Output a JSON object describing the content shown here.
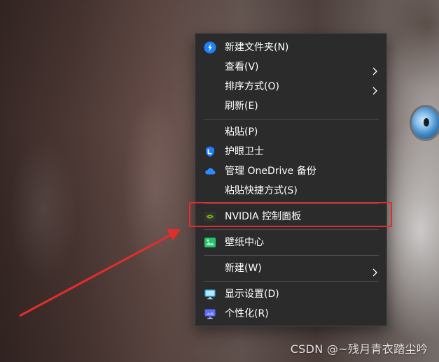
{
  "menu": {
    "items": [
      {
        "label": "新建文件夹(N)",
        "icon": "new-folder-icon"
      },
      {
        "label": "查看(V)",
        "icon": "",
        "submenu": true
      },
      {
        "label": "排序方式(O)",
        "icon": "",
        "submenu": true
      },
      {
        "label": "刷新(E)",
        "icon": ""
      },
      {
        "label": "粘贴(P)",
        "icon": ""
      },
      {
        "label": "护眼卫士",
        "icon": "shield-icon"
      },
      {
        "label": "管理 OneDrive 备份",
        "icon": "cloud-icon"
      },
      {
        "label": "粘贴快捷方式(S)",
        "icon": ""
      },
      {
        "label": "NVIDIA 控制面板",
        "icon": "nvidia-icon"
      },
      {
        "label": "壁纸中心",
        "icon": "wallpaper-icon"
      },
      {
        "label": "新建(W)",
        "icon": "",
        "submenu": true
      },
      {
        "label": "显示设置(D)",
        "icon": "monitor-icon"
      },
      {
        "label": "个性化(R)",
        "icon": "personalize-icon"
      }
    ]
  },
  "annotation": {
    "color": "#e22d2d"
  },
  "watermark": {
    "text": "CSDN @~残月青衣踏尘吟"
  },
  "colors": {
    "menu_bg": "#2b2b2b",
    "menu_border": "#4a4a4a",
    "menu_text": "#ffffff",
    "highlight": "#e22d2d",
    "onedrive_blue": "#0a84ff",
    "nvidia_green": "#76b900"
  }
}
